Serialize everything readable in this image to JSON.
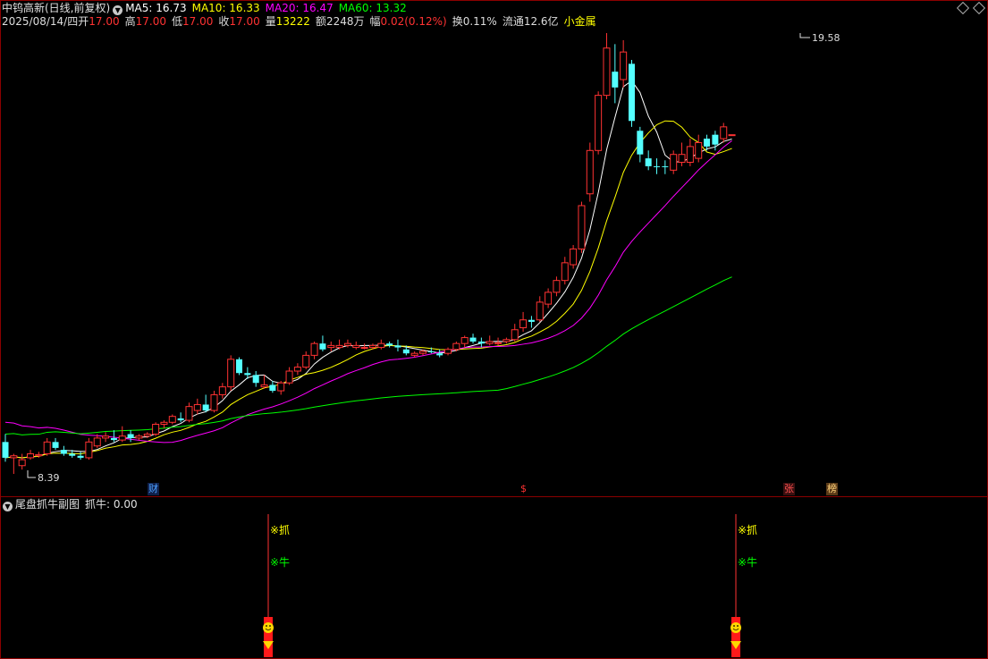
{
  "header": {
    "stock_title": "中钨高新(日线,前复权)",
    "ma5": "MA5: 16.73",
    "ma10": "MA10: 16.33",
    "ma20": "MA20: 16.47",
    "ma60": "MA60: 13.32",
    "date": "2025/08/14/四",
    "open_label": "开",
    "open": "17.00",
    "high_label": "高",
    "high": "17.00",
    "low_label": "低",
    "low": "17.00",
    "close_label": "收",
    "close": "17.00",
    "vol_label": "量",
    "vol": "13222",
    "amt_label": "额",
    "amt": "2248万",
    "chg_label": "幅",
    "chg": "0.02(0.12%)",
    "turnover": "换0.11%",
    "float": "流通12.6亿",
    "sector": "小金属"
  },
  "annotations": {
    "high_label": "19.58",
    "low_label": "8.39",
    "markers": [
      "财",
      "$",
      "张",
      "榜"
    ]
  },
  "sub_panel": {
    "title": "尾盘抓牛副图",
    "value_label": "抓牛: 0.00",
    "signal_1": "※抓",
    "signal_2": "※牛"
  },
  "colors": {
    "up": "#ff3232",
    "down": "#54ffff",
    "ma5": "#ffffff",
    "ma10": "#ffff00",
    "ma20": "#ff00ff",
    "ma60": "#00ff00"
  },
  "chart_data": {
    "type": "candlestick",
    "price_range": [
      8.39,
      19.58
    ],
    "candles": [
      {
        "o": 9.2,
        "h": 9.4,
        "l": 8.7,
        "c": 8.8
      },
      {
        "o": 8.8,
        "h": 8.9,
        "l": 8.39,
        "c": 8.85
      },
      {
        "o": 8.6,
        "h": 8.9,
        "l": 8.5,
        "c": 8.75
      },
      {
        "o": 8.8,
        "h": 9.0,
        "l": 8.75,
        "c": 8.9
      },
      {
        "o": 8.85,
        "h": 8.95,
        "l": 8.8,
        "c": 8.88
      },
      {
        "o": 8.9,
        "h": 9.3,
        "l": 8.85,
        "c": 9.2
      },
      {
        "o": 9.2,
        "h": 9.3,
        "l": 9.0,
        "c": 9.05
      },
      {
        "o": 9.0,
        "h": 9.1,
        "l": 8.85,
        "c": 8.9
      },
      {
        "o": 8.9,
        "h": 9.0,
        "l": 8.8,
        "c": 8.85
      },
      {
        "o": 8.85,
        "h": 8.95,
        "l": 8.75,
        "c": 8.8
      },
      {
        "o": 8.8,
        "h": 9.3,
        "l": 8.75,
        "c": 9.2
      },
      {
        "o": 9.1,
        "h": 9.4,
        "l": 9.05,
        "c": 9.3
      },
      {
        "o": 9.3,
        "h": 9.45,
        "l": 9.2,
        "c": 9.35
      },
      {
        "o": 9.3,
        "h": 9.5,
        "l": 9.2,
        "c": 9.25
      },
      {
        "o": 9.25,
        "h": 9.6,
        "l": 9.2,
        "c": 9.35
      },
      {
        "o": 9.4,
        "h": 9.5,
        "l": 9.2,
        "c": 9.3
      },
      {
        "o": 9.3,
        "h": 9.4,
        "l": 9.25,
        "c": 9.35
      },
      {
        "o": 9.35,
        "h": 9.45,
        "l": 9.3,
        "c": 9.4
      },
      {
        "o": 9.4,
        "h": 9.7,
        "l": 9.35,
        "c": 9.65
      },
      {
        "o": 9.65,
        "h": 9.75,
        "l": 9.55,
        "c": 9.7
      },
      {
        "o": 9.7,
        "h": 9.9,
        "l": 9.65,
        "c": 9.85
      },
      {
        "o": 9.8,
        "h": 9.95,
        "l": 9.7,
        "c": 9.75
      },
      {
        "o": 9.75,
        "h": 10.2,
        "l": 9.7,
        "c": 10.1
      },
      {
        "o": 10.0,
        "h": 10.3,
        "l": 9.9,
        "c": 10.15
      },
      {
        "o": 10.15,
        "h": 10.4,
        "l": 9.95,
        "c": 10.0
      },
      {
        "o": 10.0,
        "h": 10.5,
        "l": 9.95,
        "c": 10.4
      },
      {
        "o": 10.4,
        "h": 10.7,
        "l": 10.3,
        "c": 10.6
      },
      {
        "o": 10.6,
        "h": 11.4,
        "l": 10.5,
        "c": 11.3
      },
      {
        "o": 11.3,
        "h": 11.35,
        "l": 10.9,
        "c": 10.95
      },
      {
        "o": 10.95,
        "h": 11.1,
        "l": 10.8,
        "c": 10.9
      },
      {
        "o": 10.9,
        "h": 11.0,
        "l": 10.6,
        "c": 10.7
      },
      {
        "o": 10.6,
        "h": 10.9,
        "l": 10.55,
        "c": 10.65
      },
      {
        "o": 10.65,
        "h": 10.75,
        "l": 10.45,
        "c": 10.5
      },
      {
        "o": 10.5,
        "h": 10.75,
        "l": 10.4,
        "c": 10.7
      },
      {
        "o": 10.7,
        "h": 11.1,
        "l": 10.65,
        "c": 11.0
      },
      {
        "o": 11.0,
        "h": 11.2,
        "l": 10.9,
        "c": 11.1
      },
      {
        "o": 11.1,
        "h": 11.5,
        "l": 11.05,
        "c": 11.4
      },
      {
        "o": 11.4,
        "h": 11.75,
        "l": 11.3,
        "c": 11.7
      },
      {
        "o": 11.7,
        "h": 11.9,
        "l": 11.5,
        "c": 11.55
      },
      {
        "o": 11.6,
        "h": 11.75,
        "l": 11.5,
        "c": 11.65
      },
      {
        "o": 11.6,
        "h": 11.8,
        "l": 11.55,
        "c": 11.65
      },
      {
        "o": 11.65,
        "h": 11.8,
        "l": 11.6,
        "c": 11.7
      },
      {
        "o": 11.6,
        "h": 11.75,
        "l": 11.55,
        "c": 11.65
      },
      {
        "o": 11.6,
        "h": 11.7,
        "l": 11.55,
        "c": 11.6
      },
      {
        "o": 11.6,
        "h": 11.7,
        "l": 11.55,
        "c": 11.65
      },
      {
        "o": 11.6,
        "h": 11.8,
        "l": 11.55,
        "c": 11.7
      },
      {
        "o": 11.7,
        "h": 11.75,
        "l": 11.6,
        "c": 11.65
      },
      {
        "o": 11.65,
        "h": 11.8,
        "l": 11.5,
        "c": 11.6
      },
      {
        "o": 11.55,
        "h": 11.65,
        "l": 11.4,
        "c": 11.45
      },
      {
        "o": 11.4,
        "h": 11.5,
        "l": 11.35,
        "c": 11.45
      },
      {
        "o": 11.45,
        "h": 11.55,
        "l": 11.4,
        "c": 11.5
      },
      {
        "o": 11.5,
        "h": 11.6,
        "l": 11.45,
        "c": 11.48
      },
      {
        "o": 11.45,
        "h": 11.55,
        "l": 11.35,
        "c": 11.4
      },
      {
        "o": 11.45,
        "h": 11.6,
        "l": 11.4,
        "c": 11.55
      },
      {
        "o": 11.55,
        "h": 11.75,
        "l": 11.5,
        "c": 11.7
      },
      {
        "o": 11.7,
        "h": 11.9,
        "l": 11.6,
        "c": 11.85
      },
      {
        "o": 11.85,
        "h": 11.95,
        "l": 11.7,
        "c": 11.75
      },
      {
        "o": 11.75,
        "h": 11.85,
        "l": 11.6,
        "c": 11.7
      },
      {
        "o": 11.7,
        "h": 11.9,
        "l": 11.65,
        "c": 11.75
      },
      {
        "o": 11.7,
        "h": 11.85,
        "l": 11.65,
        "c": 11.72
      },
      {
        "o": 11.75,
        "h": 11.85,
        "l": 11.7,
        "c": 11.8
      },
      {
        "o": 11.8,
        "h": 12.2,
        "l": 11.75,
        "c": 12.05
      },
      {
        "o": 12.1,
        "h": 12.5,
        "l": 12.0,
        "c": 12.3
      },
      {
        "o": 12.3,
        "h": 12.4,
        "l": 12.1,
        "c": 12.25
      },
      {
        "o": 12.3,
        "h": 12.9,
        "l": 12.25,
        "c": 12.75
      },
      {
        "o": 12.7,
        "h": 13.1,
        "l": 12.6,
        "c": 13.0
      },
      {
        "o": 13.0,
        "h": 13.4,
        "l": 12.9,
        "c": 13.3
      },
      {
        "o": 13.3,
        "h": 13.9,
        "l": 13.2,
        "c": 13.75
      },
      {
        "o": 13.7,
        "h": 14.2,
        "l": 13.6,
        "c": 14.1
      },
      {
        "o": 14.1,
        "h": 15.3,
        "l": 14.0,
        "c": 15.2
      },
      {
        "o": 15.5,
        "h": 16.8,
        "l": 15.3,
        "c": 16.6
      },
      {
        "o": 16.6,
        "h": 18.1,
        "l": 16.5,
        "c": 18.0
      },
      {
        "o": 18.0,
        "h": 19.58,
        "l": 17.9,
        "c": 19.2
      },
      {
        "o": 18.6,
        "h": 19.3,
        "l": 17.8,
        "c": 18.2
      },
      {
        "o": 18.4,
        "h": 19.4,
        "l": 18.2,
        "c": 19.1
      },
      {
        "o": 18.8,
        "h": 18.9,
        "l": 17.2,
        "c": 17.35
      },
      {
        "o": 17.1,
        "h": 17.2,
        "l": 16.3,
        "c": 16.5
      },
      {
        "o": 16.4,
        "h": 16.6,
        "l": 16.1,
        "c": 16.2
      },
      {
        "o": 16.2,
        "h": 16.4,
        "l": 16.0,
        "c": 16.18
      },
      {
        "o": 16.2,
        "h": 16.35,
        "l": 16.0,
        "c": 16.18
      },
      {
        "o": 16.1,
        "h": 16.6,
        "l": 16.0,
        "c": 16.5
      },
      {
        "o": 16.3,
        "h": 16.8,
        "l": 16.2,
        "c": 16.5
      },
      {
        "o": 16.3,
        "h": 16.9,
        "l": 16.2,
        "c": 16.7
      },
      {
        "o": 16.4,
        "h": 17.0,
        "l": 16.3,
        "c": 16.8
      },
      {
        "o": 16.9,
        "h": 17.0,
        "l": 16.6,
        "c": 16.7
      },
      {
        "o": 17.0,
        "h": 17.1,
        "l": 16.6,
        "c": 16.75
      },
      {
        "o": 16.9,
        "h": 17.3,
        "l": 16.8,
        "c": 17.2
      },
      {
        "o": 17.0,
        "h": 17.0,
        "l": 17.0,
        "c": 17.0
      }
    ]
  }
}
